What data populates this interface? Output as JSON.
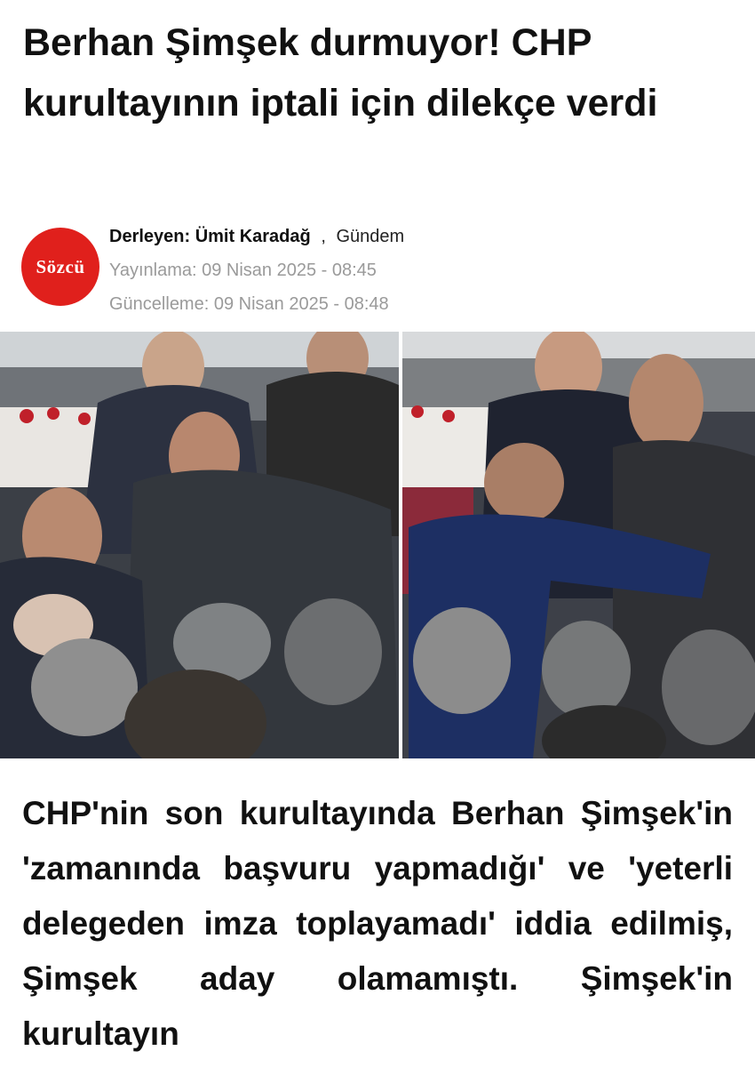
{
  "article": {
    "title": "Berhan Şimşek durmuyor! CHP kurultayının iptali için dilekçe verdi",
    "author_label": "Derleyen: Ümit Karadağ",
    "separator": ",",
    "category": "Gündem",
    "published": "Yayınlama: 09 Nisan 2025 - 08:45",
    "updated": "Güncelleme: 09 Nisan 2025 - 08:48",
    "publisher_logo_text": "Sözcü",
    "body": "CHP'nin son kurultayında Berhan Şimşek'in 'zamanında başvuru yapmadığı' ve 'yeterli delegeden imza toplayamadı' iddia edilmiş, Şimşek aday olamamıştı. Şimşek'in kurultayın"
  },
  "colors": {
    "logo_red": "#e0201c",
    "meta_gray": "#9a9a9a",
    "text": "#111111"
  },
  "image": {
    "description_icon": "photo-collage"
  }
}
